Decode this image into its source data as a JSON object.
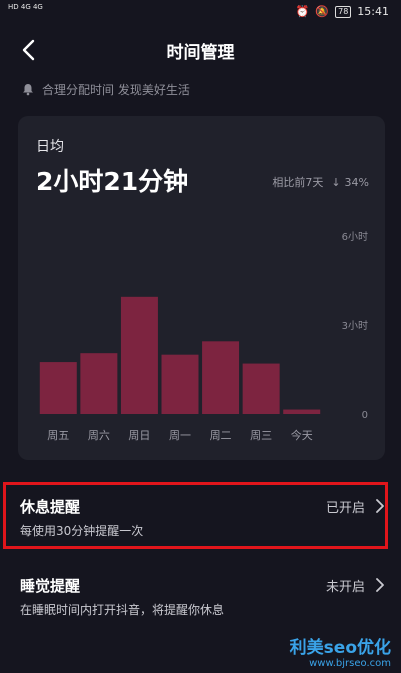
{
  "statusbar": {
    "left": "HD 4G 4G",
    "battery": "78",
    "time": "15:41"
  },
  "nav": {
    "title": "时间管理"
  },
  "tip": "合理分配时间 发现美好生活",
  "summary": {
    "label": "日均",
    "value": "2小时21分钟",
    "compare_label": "相比前7天",
    "compare_value": "34%"
  },
  "chart_data": {
    "type": "bar",
    "categories": [
      "周五",
      "周六",
      "周日",
      "周一",
      "周二",
      "周三",
      "今天"
    ],
    "values": [
      1.75,
      2.05,
      3.95,
      2.0,
      2.45,
      1.7,
      0.15
    ],
    "ylim": [
      0,
      6
    ],
    "yticks": [
      {
        "value": 6,
        "label": "6小时"
      },
      {
        "value": 3,
        "label": "3小时"
      },
      {
        "value": 0,
        "label": "0"
      }
    ],
    "bar_color": "#7d2440"
  },
  "rest_reminder": {
    "title": "休息提醒",
    "subtitle": "每使用30分钟提醒一次",
    "status": "已开启"
  },
  "sleep_reminder": {
    "title": "睡觉提醒",
    "subtitle": "在睡眠时间内打开抖音，将提醒你休息",
    "status": "未开启"
  },
  "watermark": {
    "line1": "利美seo优化",
    "line2": "www.bjrseo.com"
  }
}
